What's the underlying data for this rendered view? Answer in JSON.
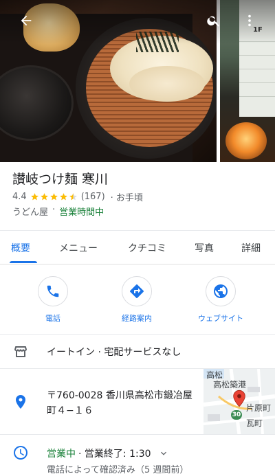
{
  "place": {
    "name": "讃岐つけ麺 寒川",
    "rating": "4.4",
    "review_count": "(167)",
    "price": "· お手頃",
    "rating_value": 4.4,
    "category": "うどん屋",
    "separator": "·",
    "status": "営業時間中"
  },
  "tabs": [
    {
      "label": "概要"
    },
    {
      "label": "メニュー"
    },
    {
      "label": "クチコミ"
    },
    {
      "label": "写真"
    },
    {
      "label": "詳細"
    }
  ],
  "actions": {
    "call": "電話",
    "directions": "経路案内",
    "website": "ウェブサイト"
  },
  "service": {
    "text": "イートイン · 宅配サービスなし"
  },
  "address": {
    "line1": "〒760-0028 香川県高松市鍛冶屋",
    "line2": "町４−１６"
  },
  "map": {
    "label1": "高松",
    "label2": "高松築港",
    "label3": "片原町",
    "label4": "瓦町",
    "route": "30",
    "station": "1F"
  },
  "hours": {
    "status": "営業中",
    "closing": "· 営業終了: 1:30",
    "verified": "電話によって確認済み（5 週間前）"
  },
  "colors": {
    "accent": "#1a73e8",
    "open": "#188038",
    "star": "#fbbc04",
    "pin": "#ea4335"
  },
  "icons": {
    "back": "arrow-left-icon",
    "search": "search-icon",
    "more": "more-vert-icon",
    "call": "phone-icon",
    "directions": "directions-icon",
    "website": "globe-icon",
    "service": "storefront-icon",
    "address": "location-pin-icon",
    "hours": "clock-icon"
  }
}
